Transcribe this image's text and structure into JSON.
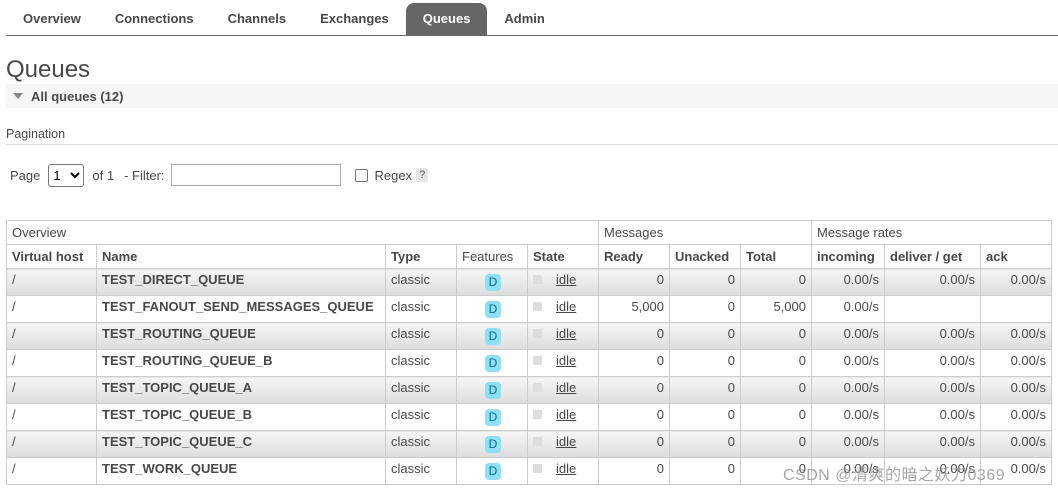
{
  "tabs": [
    "Overview",
    "Connections",
    "Channels",
    "Exchanges",
    "Queues",
    "Admin"
  ],
  "title": "Queues",
  "section_label": "All queues (12)",
  "pagination": {
    "title": "Pagination",
    "page_label": "Page",
    "page_value": "1",
    "of_label": "of 1",
    "filter_label": "- Filter:",
    "filter_value": "",
    "regex_label": "Regex",
    "help": "?"
  },
  "table": {
    "groups": [
      "Overview",
      "Messages",
      "Message rates"
    ],
    "columns": [
      "Virtual host",
      "Name",
      "Type",
      "Features",
      "State",
      "Ready",
      "Unacked",
      "Total",
      "incoming",
      "deliver / get",
      "ack"
    ],
    "rows": [
      {
        "vhost": "/",
        "name": "TEST_DIRECT_QUEUE",
        "type": "classic",
        "feature": "D",
        "state": "idle",
        "ready": "0",
        "unacked": "0",
        "total": "0",
        "incoming": "0.00/s",
        "deliver": "0.00/s",
        "ack": "0.00/s"
      },
      {
        "vhost": "/",
        "name": "TEST_FANOUT_SEND_MESSAGES_QUEUE",
        "type": "classic",
        "feature": "D",
        "state": "idle",
        "ready": "5,000",
        "unacked": "0",
        "total": "5,000",
        "incoming": "0.00/s",
        "deliver": "",
        "ack": ""
      },
      {
        "vhost": "/",
        "name": "TEST_ROUTING_QUEUE",
        "type": "classic",
        "feature": "D",
        "state": "idle",
        "ready": "0",
        "unacked": "0",
        "total": "0",
        "incoming": "0.00/s",
        "deliver": "0.00/s",
        "ack": "0.00/s"
      },
      {
        "vhost": "/",
        "name": "TEST_ROUTING_QUEUE_B",
        "type": "classic",
        "feature": "D",
        "state": "idle",
        "ready": "0",
        "unacked": "0",
        "total": "0",
        "incoming": "0.00/s",
        "deliver": "0.00/s",
        "ack": "0.00/s"
      },
      {
        "vhost": "/",
        "name": "TEST_TOPIC_QUEUE_A",
        "type": "classic",
        "feature": "D",
        "state": "idle",
        "ready": "0",
        "unacked": "0",
        "total": "0",
        "incoming": "0.00/s",
        "deliver": "0.00/s",
        "ack": "0.00/s"
      },
      {
        "vhost": "/",
        "name": "TEST_TOPIC_QUEUE_B",
        "type": "classic",
        "feature": "D",
        "state": "idle",
        "ready": "0",
        "unacked": "0",
        "total": "0",
        "incoming": "0.00/s",
        "deliver": "0.00/s",
        "ack": "0.00/s"
      },
      {
        "vhost": "/",
        "name": "TEST_TOPIC_QUEUE_C",
        "type": "classic",
        "feature": "D",
        "state": "idle",
        "ready": "0",
        "unacked": "0",
        "total": "0",
        "incoming": "0.00/s",
        "deliver": "0.00/s",
        "ack": "0.00/s"
      },
      {
        "vhost": "/",
        "name": "TEST_WORK_QUEUE",
        "type": "classic",
        "feature": "D",
        "state": "idle",
        "ready": "0",
        "unacked": "0",
        "total": "0",
        "incoming": "0.00/s",
        "deliver": "0.00/s",
        "ack": "0.00/s"
      }
    ]
  },
  "watermark": "CSDN @清爽的暗之妖刀0369"
}
